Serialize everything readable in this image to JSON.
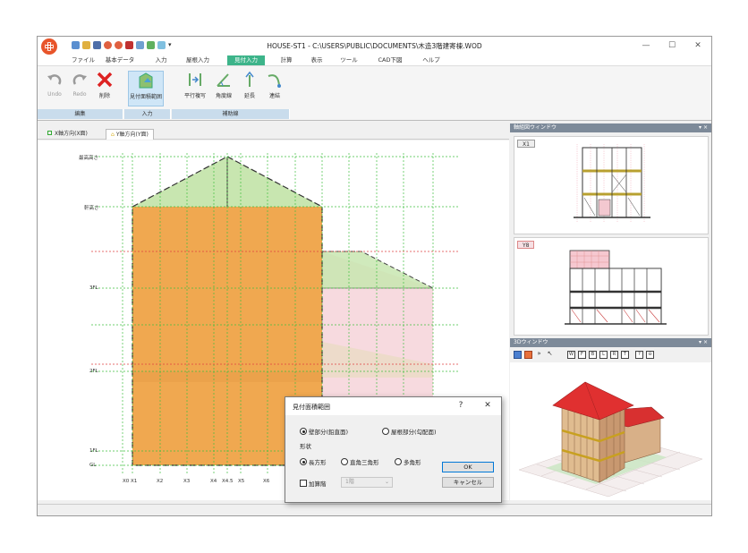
{
  "window": {
    "title": "HOUSE-ST1 - C:\\USERS\\PUBLIC\\DOCUMENTS\\木造3階建寄棟.WOD",
    "minimize": "—",
    "maximize": "☐",
    "close": "✕"
  },
  "menu": {
    "tabs": [
      "ファイル",
      "基本データ",
      "入力",
      "屋根入力",
      "見付入力",
      "計算",
      "表示",
      "ツール",
      "CAD下図",
      "ヘルプ"
    ],
    "active": "見付入力"
  },
  "ribbon": {
    "undo": "Undo",
    "redo": "Redo",
    "delete": "削除",
    "mitsuke_area": "見付面積範囲",
    "parallel_copy": "平行複写",
    "angle_line": "角度線",
    "extend": "延長",
    "connect": "連結",
    "groups": [
      "編集",
      "入力",
      "補助線"
    ]
  },
  "doc_tabs": [
    "X軸方向(X面)",
    "Y軸方向(Y面)"
  ],
  "drawing": {
    "level_labels": [
      "最高高さ",
      "軒高さ",
      "3FL",
      "2FL",
      "1FL",
      "GL"
    ],
    "axis_labels": [
      "X0",
      "X1",
      "X2",
      "X3",
      "X4",
      "X4.5",
      "X5",
      "X6"
    ]
  },
  "panels": {
    "axis_window_title": "軸組図ウィンドウ",
    "axis_x_label": "X1",
    "axis_y_label": "Y8",
    "view3d_title": "3Dウィンドウ",
    "panel_controls": "▾ ×"
  },
  "dialog": {
    "title": "見付面積範囲",
    "help": "?",
    "close": "✕",
    "radio_wall": "壁部分(鉛直面)",
    "radio_roof": "屋根部分(勾配面)",
    "shape_label": "形状",
    "shape_rect": "長方形",
    "shape_right_triangle": "直角三角形",
    "shape_polygon": "多角形",
    "ok": "OK",
    "cancel": "キャンセル",
    "add_floor_label": "加算階",
    "floor_value": "1階",
    "selected_part": "wall",
    "selected_shape": "rect"
  },
  "colors": {
    "active_tab": "#3db48a",
    "wall_fill": "#f0a850",
    "roof_fill": "#c8e6b0",
    "rear_fill": "#f6d6dc",
    "grid": "#40c040",
    "panel_head": "#7d8a99"
  }
}
